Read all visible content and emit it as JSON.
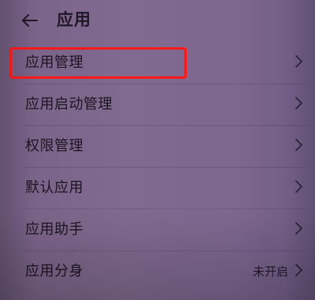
{
  "header": {
    "title": "应用",
    "back_icon": "back-arrow-icon"
  },
  "items": [
    {
      "label": "应用管理",
      "value": "",
      "highlighted": true
    },
    {
      "label": "应用启动管理",
      "value": ""
    },
    {
      "label": "权限管理",
      "value": ""
    },
    {
      "label": "默认应用",
      "value": ""
    },
    {
      "label": "应用助手",
      "value": ""
    },
    {
      "label": "应用分身",
      "value": "未开启"
    }
  ],
  "colors": {
    "background": "#7e6790",
    "text": "#1b1420",
    "highlight": "#ff1a1a"
  }
}
